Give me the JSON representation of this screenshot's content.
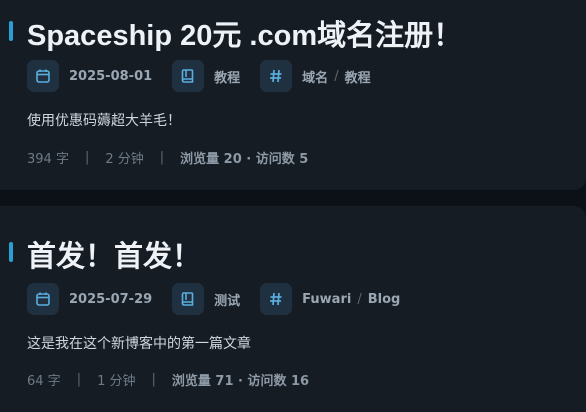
{
  "posts": [
    {
      "title": "Spaceship 20元 .com域名注册！",
      "date": "2025-08-01",
      "category": "教程",
      "tags": [
        "域名",
        "教程"
      ],
      "tag_separator": "/",
      "description": "使用优惠码薅超大羊毛！",
      "word_count": "394 字",
      "read_time": "2 分钟",
      "views": "浏览量 20 · 访问数 5"
    },
    {
      "title": "首发！首发！",
      "date": "2025-07-29",
      "category": "测试",
      "tags": [
        "Fuwari",
        "Blog"
      ],
      "tag_separator": "/",
      "description": "这是我在这个新博客中的第一篇文章",
      "word_count": "64 字",
      "read_time": "1 分钟",
      "views": "浏览量 71 · 访问数 16"
    }
  ],
  "stats_separator": "|",
  "colors": {
    "background": "#0b1117",
    "card": "#151c24",
    "accent": "#2a9fd6",
    "icon_box": "#1f3140",
    "icon": "#5aaee0"
  },
  "icons": {
    "date": "calendar-icon",
    "category": "book-icon",
    "tags": "hash-icon"
  }
}
